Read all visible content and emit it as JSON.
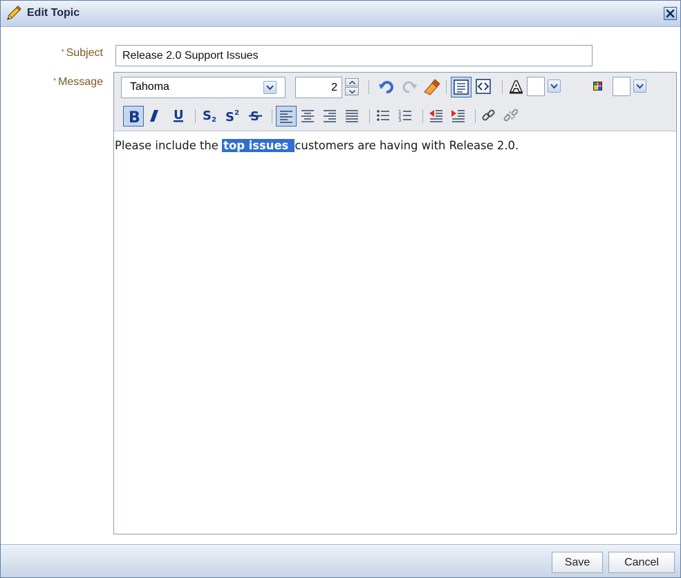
{
  "dialog": {
    "title": "Edit Topic",
    "close_icon": "close-x-icon"
  },
  "form": {
    "subject": {
      "required_mark": "*",
      "label": "Subject",
      "value": "Release 2.0 Support Issues"
    },
    "message": {
      "required_mark": "*",
      "label": "Message"
    }
  },
  "toolbar": {
    "font_family": "Tahoma",
    "font_size": "2",
    "row1_icons": [
      "undo-icon",
      "redo-icon",
      "clear-formatting-eraser-icon",
      "rich-text-mode-icon",
      "source-code-mode-icon",
      "font-color-icon",
      "background-color-icon"
    ],
    "row2_icons": [
      "bold-icon",
      "italic-icon",
      "underline-icon",
      "subscript-icon",
      "superscript-icon",
      "strikethrough-icon",
      "align-left-icon",
      "align-center-icon",
      "align-right-icon",
      "justify-icon",
      "bullet-list-icon",
      "numbered-list-icon",
      "outdent-icon",
      "indent-icon",
      "insert-link-icon",
      "remove-link-icon"
    ],
    "active": [
      "rich-text-mode-icon",
      "bold-icon",
      "align-left-icon"
    ]
  },
  "content": {
    "before": "Please include the ",
    "selected": "top issues",
    "after": "customers are having with Release 2.0."
  },
  "footer": {
    "save_label": "Save",
    "cancel_label": "Cancel"
  },
  "colors": {
    "selection": "#2f6ed1",
    "label": "#7b5a1e",
    "titlebar": "#d3dfee"
  }
}
